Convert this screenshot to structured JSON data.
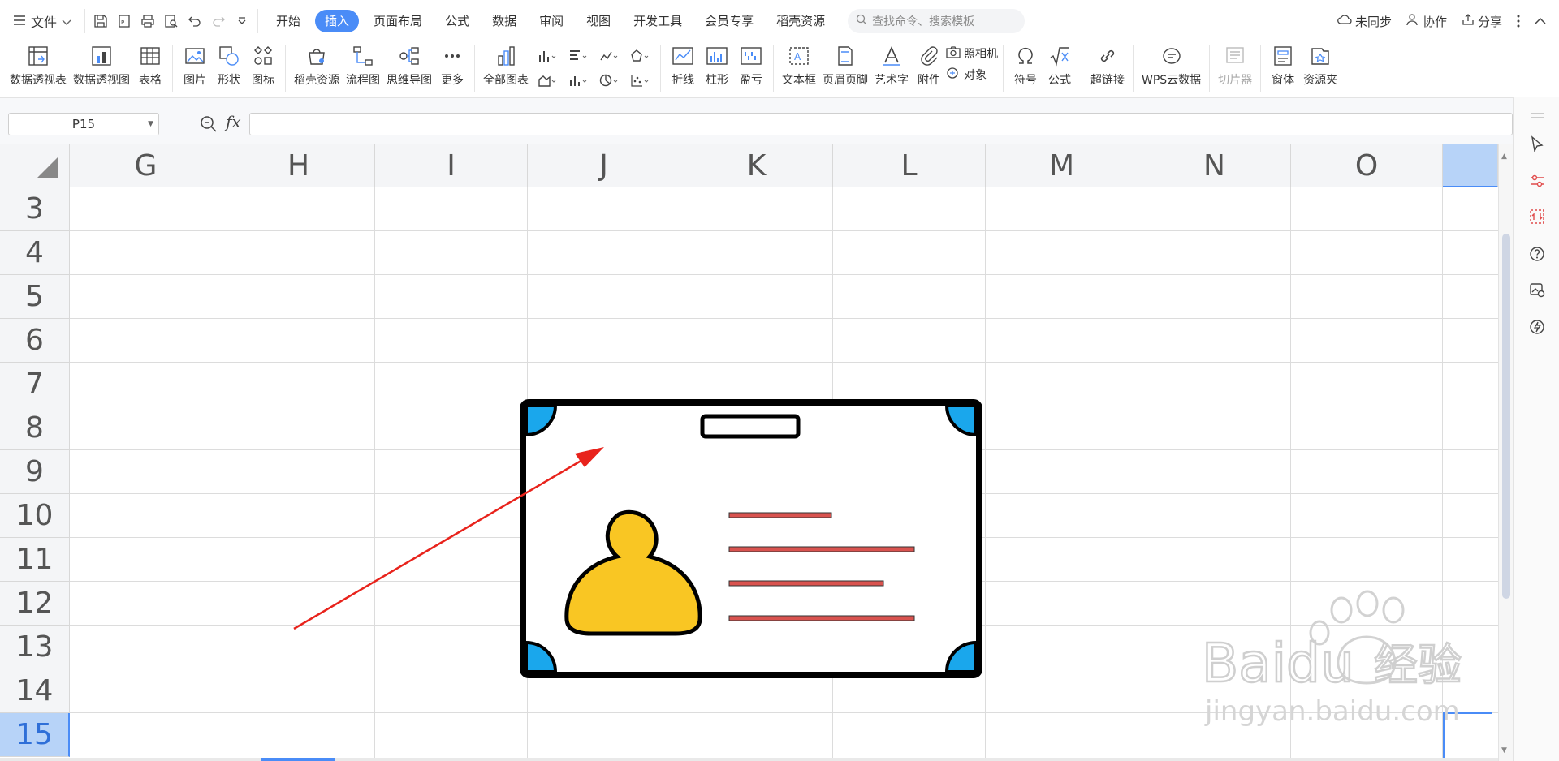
{
  "menubar": {
    "file_label": "文件",
    "tabs": [
      {
        "label": "开始"
      },
      {
        "label": "插入",
        "active": true
      },
      {
        "label": "页面布局"
      },
      {
        "label": "公式"
      },
      {
        "label": "数据"
      },
      {
        "label": "审阅"
      },
      {
        "label": "视图"
      },
      {
        "label": "开发工具"
      },
      {
        "label": "会员专享"
      },
      {
        "label": "稻壳资源"
      }
    ],
    "search_placeholder": "查找命令、搜索模板",
    "right": {
      "sync": "未同步",
      "collab": "协作",
      "share": "分享"
    }
  },
  "ribbon": {
    "items": [
      {
        "label": "数据透视表",
        "icon": "pivot-table-icon"
      },
      {
        "label": "数据透视图",
        "icon": "pivot-chart-icon"
      },
      {
        "label": "表格",
        "icon": "table-icon"
      },
      {
        "label": "图片",
        "icon": "picture-icon"
      },
      {
        "label": "形状",
        "icon": "shape-icon"
      },
      {
        "label": "图标",
        "icon": "icon-library-icon"
      },
      {
        "label": "稻壳资源",
        "icon": "docer-resource-icon"
      },
      {
        "label": "流程图",
        "icon": "flowchart-icon"
      },
      {
        "label": "思维导图",
        "icon": "mindmap-icon"
      },
      {
        "label": "更多",
        "icon": "more-icon"
      },
      {
        "label": "全部图表",
        "icon": "all-charts-icon"
      },
      {
        "label": "折线",
        "icon": "sparkline-line-icon"
      },
      {
        "label": "柱形",
        "icon": "sparkline-column-icon"
      },
      {
        "label": "盈亏",
        "icon": "sparkline-winloss-icon"
      },
      {
        "label": "文本框",
        "icon": "textbox-icon"
      },
      {
        "label": "页眉页脚",
        "icon": "header-footer-icon"
      },
      {
        "label": "艺术字",
        "icon": "wordart-icon"
      },
      {
        "label": "附件",
        "icon": "attachment-icon"
      },
      {
        "label": "照相机",
        "icon": "camera-icon"
      },
      {
        "label": "对象",
        "icon": "object-icon"
      },
      {
        "label": "符号",
        "icon": "symbol-icon"
      },
      {
        "label": "公式",
        "icon": "equation-icon"
      },
      {
        "label": "超链接",
        "icon": "hyperlink-icon"
      },
      {
        "label": "WPS云数据",
        "icon": "cloud-data-icon"
      },
      {
        "label": "切片器",
        "icon": "slicer-icon"
      },
      {
        "label": "窗体",
        "icon": "form-icon"
      },
      {
        "label": "资源夹",
        "icon": "resource-folder-icon"
      }
    ]
  },
  "formula_bar": {
    "name_box": "P15",
    "fx": "fx",
    "value": ""
  },
  "sheet": {
    "columns": [
      "G",
      "H",
      "I",
      "J",
      "K",
      "L",
      "M",
      "N",
      "O"
    ],
    "rows": [
      "3",
      "4",
      "5",
      "6",
      "7",
      "8",
      "9",
      "10",
      "11",
      "12",
      "13",
      "14",
      "15"
    ],
    "selected_row": "15",
    "selected_cell": "P15"
  },
  "colors": {
    "accent": "#4a8cf7",
    "card_border": "#000000",
    "card_corner": "#1aa7ec",
    "person": "#f9c623",
    "text_lines": "#d9534f",
    "arrow": "#e8231c"
  },
  "watermark": {
    "brand": "Baidu",
    "cn": "经验",
    "url": "jingyan.baidu.com"
  }
}
